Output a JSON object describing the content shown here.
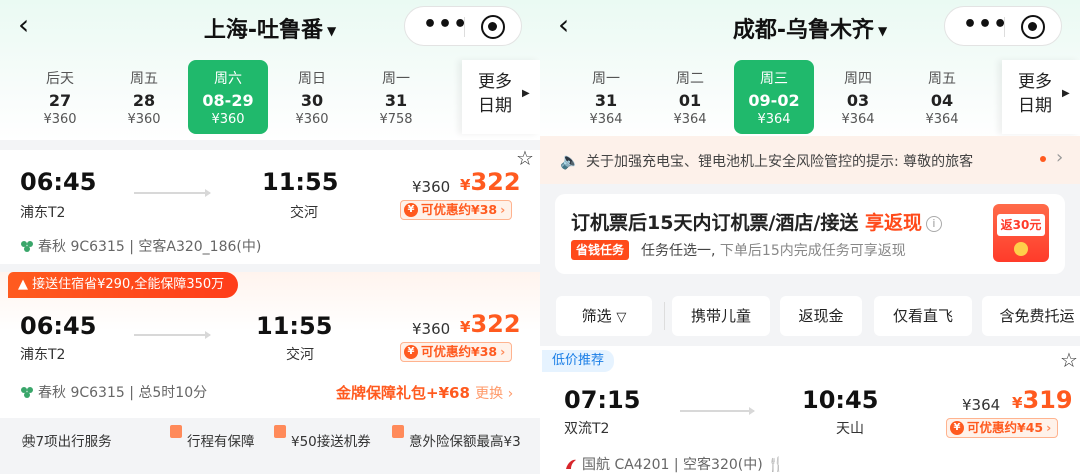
{
  "colors": {
    "accent_green": "#20b96c",
    "price_orange": "#ff5a1f",
    "promo_red": "#ff4a1a",
    "low_price_blue": "#1a7ee6"
  },
  "icons": {
    "back": "chevron-left-icon",
    "more": "more-dots-icon",
    "target": "target-circle-icon",
    "star": "star-outline-icon",
    "speaker": "speaker-icon"
  },
  "left": {
    "route": "上海-吐鲁番",
    "dates": [
      {
        "dow": "后天",
        "date": "27",
        "price": "¥360"
      },
      {
        "dow": "周五",
        "date": "28",
        "price": "¥360"
      },
      {
        "dow": "周六",
        "date": "08-29",
        "price": "¥360",
        "selected": true
      },
      {
        "dow": "周日",
        "date": "30",
        "price": "¥360"
      },
      {
        "dow": "周一",
        "date": "31",
        "price": "¥758"
      }
    ],
    "more_dates": "更多日期",
    "flight1": {
      "dep_time": "06:45",
      "dep_airport": "浦东T2",
      "arr_time": "11:55",
      "arr_airport": "交河",
      "orig_price": "¥360",
      "cur": "¥",
      "price": "322",
      "discount": "可优惠约¥38",
      "airline": "春秋 9C6315 | 空客A320_186(中)"
    },
    "promo_tag": "接送住宿省¥290,全能保障350万",
    "flight2": {
      "dep_time": "06:45",
      "dep_airport": "浦东T2",
      "arr_time": "11:55",
      "arr_airport": "交河",
      "orig_price": "¥360",
      "cur": "¥",
      "price": "322",
      "discount": "可优惠约¥38",
      "airline": "春秋 9C6315 | 总5时10分",
      "gold_pack": "金牌保障礼包+¥68",
      "gold_switch": "更换"
    },
    "services": {
      "count": "共7项出行服务",
      "s1": "行程有保障",
      "s2": "¥50接送机券",
      "s3": "意外险保额最高¥3"
    }
  },
  "right": {
    "route": "成都-乌鲁木齐",
    "dates": [
      {
        "dow": "周一",
        "date": "31",
        "price": "¥364"
      },
      {
        "dow": "周二",
        "date": "01",
        "price": "¥364"
      },
      {
        "dow": "周三",
        "date": "09-02",
        "price": "¥364",
        "selected": true
      },
      {
        "dow": "周四",
        "date": "03",
        "price": "¥364"
      },
      {
        "dow": "周五",
        "date": "04",
        "price": "¥364"
      }
    ],
    "more_dates": "更多日期",
    "notice": "关于加强充电宝、锂电池机上安全风险管控的提示: 尊敬的旅客",
    "banner": {
      "title_main": "订机票后15天内订机票/酒店/接送 ",
      "title_hl": "享返现",
      "badge": "省钱任务",
      "desc1": "任务任选一,",
      "desc2": "下单后15内完成任务可享返现",
      "envelope": "返30元"
    },
    "filters": [
      "筛选",
      "携带儿童",
      "返现金",
      "仅看直飞",
      "含免费托运"
    ],
    "low_tag": "低价推荐",
    "flight": {
      "dep_time": "07:15",
      "dep_airport": "双流T2",
      "arr_time": "10:45",
      "arr_airport": "天山",
      "orig_price": "¥364",
      "cur": "¥",
      "price": "319",
      "discount": "可优惠约¥45",
      "airline": "国航 CA4201 | 空客320(中)"
    }
  }
}
